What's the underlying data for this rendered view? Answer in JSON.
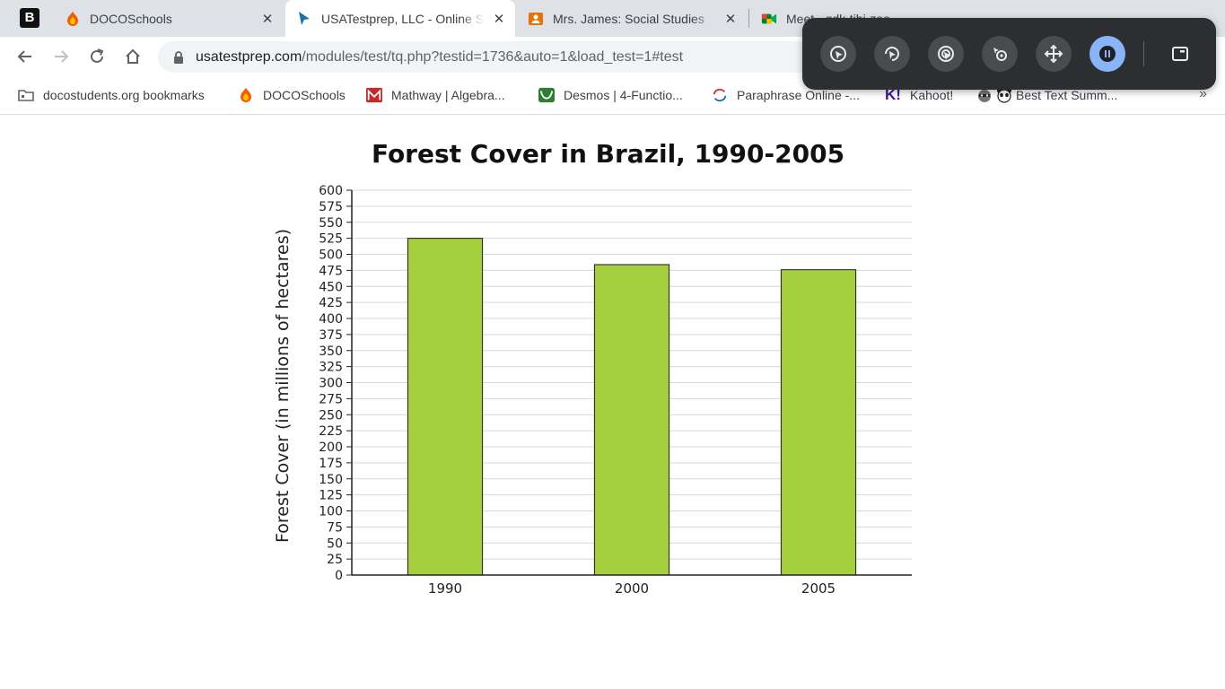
{
  "browser": {
    "tabs": [
      {
        "title": "DOCOSchools",
        "active": false
      },
      {
        "title": "USATestprep, LLC - Online S",
        "active": true
      },
      {
        "title": "Mrs. James: Social Studies",
        "active": false
      },
      {
        "title": "Meet - gdk-tibi-zoo",
        "active": false
      }
    ],
    "url_host": "usatestprep.com",
    "url_path": "/modules/test/tq.php?testid=1736&auto=1&load_test=1#test",
    "bookmarks": [
      {
        "label": "docostudents.org bookmarks",
        "icon": "folder-icon"
      },
      {
        "label": "DOCOSchools",
        "icon": "docoschools-icon"
      },
      {
        "label": "Mathway | Algebra...",
        "icon": "mathway-icon"
      },
      {
        "label": "Desmos | 4-Functio...",
        "icon": "desmos-icon"
      },
      {
        "label": "Paraphrase Online -...",
        "icon": "paraphrase-icon"
      },
      {
        "label": "Kahoot!",
        "icon": "kahoot-icon"
      },
      {
        "label": "Best Text Summ...",
        "icon": "panda-icon"
      }
    ],
    "bookmarks_more": "»"
  },
  "capture_bar": {
    "buttons": [
      "cursor-icon",
      "rotate-cursor-icon",
      "cursor-ring-icon",
      "cursor-target-icon",
      "move-icon",
      "pause-icon"
    ],
    "window_button": "window-icon"
  },
  "chart_data": {
    "type": "bar",
    "title": "Forest Cover in Brazil, 1990-2005",
    "xlabel": "",
    "ylabel": "Forest Cover (in millions of hectares)",
    "categories": [
      "1990",
      "2000",
      "2005"
    ],
    "values": [
      525,
      484,
      476
    ],
    "ylim": [
      0,
      600
    ],
    "ytick_step": 25,
    "grid": true,
    "bar_color": "#a4cf3e",
    "bar_edge_color": "#1a1a1a"
  }
}
